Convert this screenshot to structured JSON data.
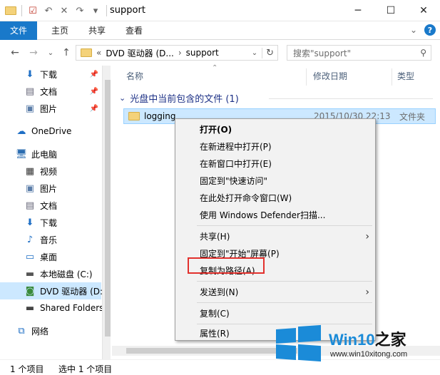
{
  "window": {
    "title": "support",
    "controls": {
      "minimize": "─",
      "maximize": "☐",
      "close": "✕"
    }
  },
  "ribbon": {
    "tabs": [
      "文件",
      "主页",
      "共享",
      "查看"
    ]
  },
  "navigation": {
    "path": [
      "«",
      "DVD 驱动器 (D...",
      "›",
      "support"
    ],
    "search_placeholder": "搜索\"support\""
  },
  "sidebar": {
    "items": [
      {
        "label": "下载",
        "icon": "download-arrow-icon",
        "pinned": true
      },
      {
        "label": "文档",
        "icon": "document-icon",
        "pinned": true
      },
      {
        "label": "图片",
        "icon": "picture-icon",
        "pinned": true
      },
      {
        "label": "OneDrive",
        "icon": "cloud-icon",
        "pinned": false
      },
      {
        "label": "此电脑",
        "icon": "computer-icon",
        "pinned": false
      },
      {
        "label": "视频",
        "icon": "video-icon",
        "pinned": false
      },
      {
        "label": "图片",
        "icon": "picture-icon",
        "pinned": false
      },
      {
        "label": "文档",
        "icon": "document-icon",
        "pinned": false
      },
      {
        "label": "下载",
        "icon": "download-arrow-icon",
        "pinned": false
      },
      {
        "label": "音乐",
        "icon": "music-note-icon",
        "pinned": false
      },
      {
        "label": "桌面",
        "icon": "desktop-icon",
        "pinned": false
      },
      {
        "label": "本地磁盘 (C:)",
        "icon": "hard-drive-icon",
        "pinned": false
      },
      {
        "label": "DVD 驱动器 (D:",
        "icon": "dvd-drive-icon",
        "pinned": false,
        "selected": true
      },
      {
        "label": "Shared Folders",
        "icon": "network-drive-icon",
        "pinned": false
      },
      {
        "label": "网络",
        "icon": "network-icon",
        "pinned": false
      }
    ]
  },
  "content": {
    "columns": {
      "name": "名称",
      "date": "修改日期",
      "type": "类型"
    },
    "group_label": "光盘中当前包含的文件 (1)",
    "files": [
      {
        "name": "logging",
        "date": "2015/10/30 22:13",
        "type": "文件夹"
      }
    ]
  },
  "context_menu": {
    "items": [
      {
        "label": "打开(O)",
        "bold": true
      },
      {
        "label": "在新进程中打开(P)"
      },
      {
        "label": "在新窗口中打开(E)"
      },
      {
        "label": "固定到\"快速访问\""
      },
      {
        "label": "在此处打开命令窗口(W)"
      },
      {
        "label": "使用 Windows Defender扫描..."
      },
      {
        "label": "共享(H)",
        "submenu": true
      },
      {
        "label": "固定到\"开始\"屏幕(P)"
      },
      {
        "label": "复制为路径(A)",
        "highlighted": true
      },
      {
        "label": "发送到(N)",
        "submenu": true
      },
      {
        "label": "复制(C)"
      },
      {
        "label": "属性(R)"
      }
    ]
  },
  "status_bar": {
    "item_count": "1 个项目",
    "selected": "选中 1 个项目"
  },
  "watermark": {
    "brand": "Win10",
    "brand_suffix": "之家",
    "url": "www.win10xitong.com"
  },
  "colors": {
    "accent": "#1979ca",
    "selection": "#cce8ff",
    "highlight_border": "#e2312d",
    "watermark_blue": "#1b8bd8"
  }
}
